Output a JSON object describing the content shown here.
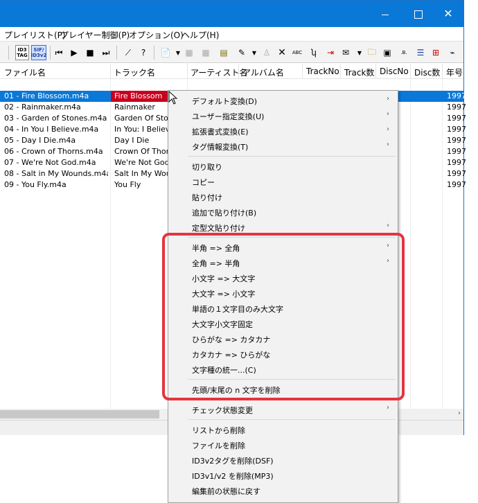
{
  "window": {
    "minimize": "—",
    "maximize": "□",
    "close": "✕"
  },
  "menubar": [
    {
      "label": "プレイリスト(P)"
    },
    {
      "label": "プレイヤー制御(P)"
    },
    {
      "label": "オプション(O)"
    },
    {
      "label": "ヘルプ(H)"
    }
  ],
  "toolbar": {
    "tag_top": "ID3",
    "tag_bottom": "TAG",
    "sif_top": "SIF/",
    "sif_bottom": "ID3v2",
    "icons": [
      "prev-icon",
      "play-icon",
      "stop-icon",
      "next-icon",
      "wand-icon",
      "help-icon",
      "convert-icon",
      "grid-icon",
      "table-icon",
      "list-icon",
      "abc-icon",
      "delete-icon",
      "case-icon",
      "replace-icon",
      "sort-icon",
      "folder-icon",
      "lock-icon",
      "text-icon",
      "flag-icon",
      "exec-icon"
    ]
  },
  "columns": [
    "ファイル名",
    "トラック名",
    "アーティスト名",
    "アルバム名",
    "TrackNo",
    "Track数",
    "DiscNo",
    "Disc数",
    "年号"
  ],
  "rows": [
    {
      "file": "01 - Fire Blossom.m4a",
      "track": "Fire Blossom",
      "year": "1997"
    },
    {
      "file": "02 - Rainmaker.m4a",
      "track": "Rainmaker",
      "year": "1997"
    },
    {
      "file": "03 - Garden of Stones.m4a",
      "track": "Garden Of Stor",
      "year": "1997"
    },
    {
      "file": "04 - In You I Believe.m4a",
      "track": "In You: I Believ",
      "year": "1997"
    },
    {
      "file": "05 - Day I Die.m4a",
      "track": "Day I Die",
      "year": "1997"
    },
    {
      "file": "06 - Crown of Thorns.m4a",
      "track": "Crown Of Thor",
      "year": "1997"
    },
    {
      "file": "07 - We're Not God.m4a",
      "track": "We're Not God",
      "year": "1997"
    },
    {
      "file": "08 - Salt in My Wounds.m4a",
      "track": "Salt In My Wou",
      "year": "1997"
    },
    {
      "file": "09 - You Fly.m4a",
      "track": "You Fly",
      "year": "1997"
    }
  ],
  "hscroll_arrow": "›",
  "context_menu": {
    "group1": [
      {
        "label": "デフォルト変換(D)",
        "submenu": true
      },
      {
        "label": "ユーザー指定変換(U)",
        "submenu": true
      },
      {
        "label": "拡張書式変換(E)",
        "submenu": true
      },
      {
        "label": "タグ情報変換(T)",
        "submenu": true
      }
    ],
    "group2": [
      {
        "label": "切り取り",
        "submenu": false
      },
      {
        "label": "コピー",
        "submenu": false
      },
      {
        "label": "貼り付け",
        "submenu": false
      },
      {
        "label": "追加で貼り付け(B)",
        "submenu": false
      },
      {
        "label": "定型文貼り付け",
        "submenu": true
      }
    ],
    "group3": [
      {
        "label": "半角 => 全角",
        "submenu": true
      },
      {
        "label": "全角 => 半角",
        "submenu": true
      },
      {
        "label": "小文字 => 大文字",
        "submenu": false
      },
      {
        "label": "大文字 => 小文字",
        "submenu": false
      },
      {
        "label": "単語の１文字目のみ大文字",
        "submenu": false
      },
      {
        "label": "大文字小文字固定",
        "submenu": false
      },
      {
        "label": "ひらがな => カタカナ",
        "submenu": false
      },
      {
        "label": "カタカナ => ひらがな",
        "submenu": false
      },
      {
        "label": "文字種の統一...(C)",
        "submenu": false
      }
    ],
    "group4": [
      {
        "label": "先頭/末尾の n 文字を削除",
        "submenu": false
      }
    ],
    "group5": [
      {
        "label": "チェック状態変更",
        "submenu": true
      }
    ],
    "group6": [
      {
        "label": "リストから削除",
        "submenu": false
      },
      {
        "label": "ファイルを削除",
        "submenu": false
      },
      {
        "label": "ID3v2タグを削除(DSF)",
        "submenu": false
      },
      {
        "label": "ID3v1/v2 を削除(MP3)",
        "submenu": false
      },
      {
        "label": "編集前の状態に戻す",
        "submenu": false
      }
    ],
    "submenu_arrow": "›"
  },
  "colors": {
    "titlebar": "#0a78d7",
    "selection": "#0a78d7",
    "track_highlight": "#c8001e",
    "annotation": "#e5343f"
  }
}
